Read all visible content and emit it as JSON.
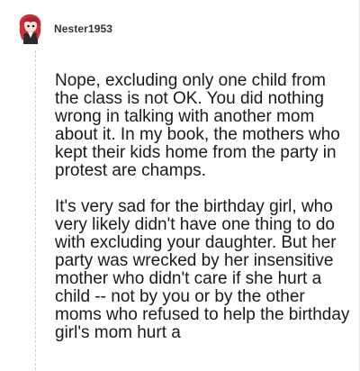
{
  "comment": {
    "username": "Nester1953",
    "avatar_icon": "anime-girl-avatar-icon",
    "paragraphs": [
      "Nope, excluding only one child from the class is not OK. You did nothing wrong in talking with another mom about it. In my book, the mothers who kept their kids home from the party in protest are champs.",
      "It's very sad for the birthday girl, who very likely didn't have one thing to do with excluding your daughter. But her party was wrecked by her insensitive mother who didn't care if she hurt a child -- not by you or by the other moms who refused to help the birthday girl's mom hurt a"
    ]
  },
  "colors": {
    "avatar_hair": "#c8323c",
    "text": "#1a1a1a",
    "thread_line": "#cfcfcf"
  }
}
